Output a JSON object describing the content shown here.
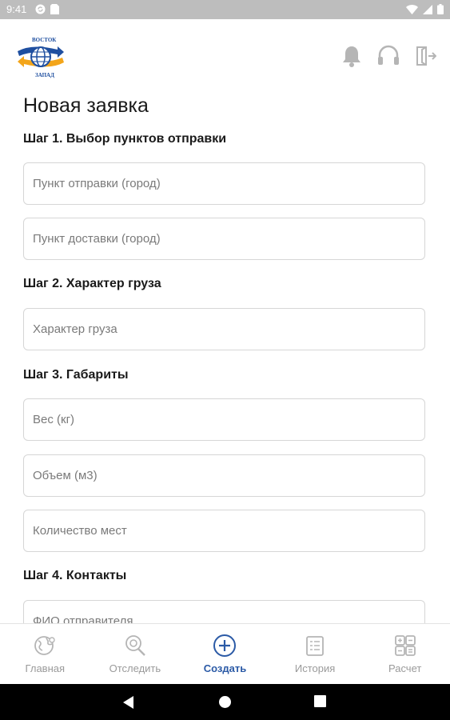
{
  "status_bar": {
    "time": "9:41"
  },
  "logo": {
    "top_text": "ВОСТОК",
    "bottom_text": "ЗАПАД"
  },
  "page": {
    "title": "Новая заявка"
  },
  "steps": [
    {
      "label": "Шаг 1. Выбор пунктов отправки",
      "fields": [
        "Пункт отправки (город)",
        "Пункт доставки (город)"
      ]
    },
    {
      "label": "Шаг 2. Характер груза",
      "fields": [
        "Характер груза"
      ]
    },
    {
      "label": "Шаг 3. Габариты",
      "fields": [
        "Вес (кг)",
        "Объем (м3)",
        "Количество мест"
      ]
    },
    {
      "label": "Шаг 4. Контакты",
      "fields": [
        "ФИО отправителя"
      ]
    }
  ],
  "bottom_nav": [
    {
      "label": "Главная",
      "icon": "globe-icon",
      "active": false
    },
    {
      "label": "Отследить",
      "icon": "track-search-icon",
      "active": false
    },
    {
      "label": "Создать",
      "icon": "plus-circle-icon",
      "active": true
    },
    {
      "label": "История",
      "icon": "history-list-icon",
      "active": false
    },
    {
      "label": "Расчет",
      "icon": "calculator-icon",
      "active": false
    }
  ],
  "colors": {
    "accent": "#2b5aa6",
    "logo_blue": "#1f4fa0",
    "logo_orange": "#f3a51a",
    "icon_gray": "#b5b5b5"
  }
}
